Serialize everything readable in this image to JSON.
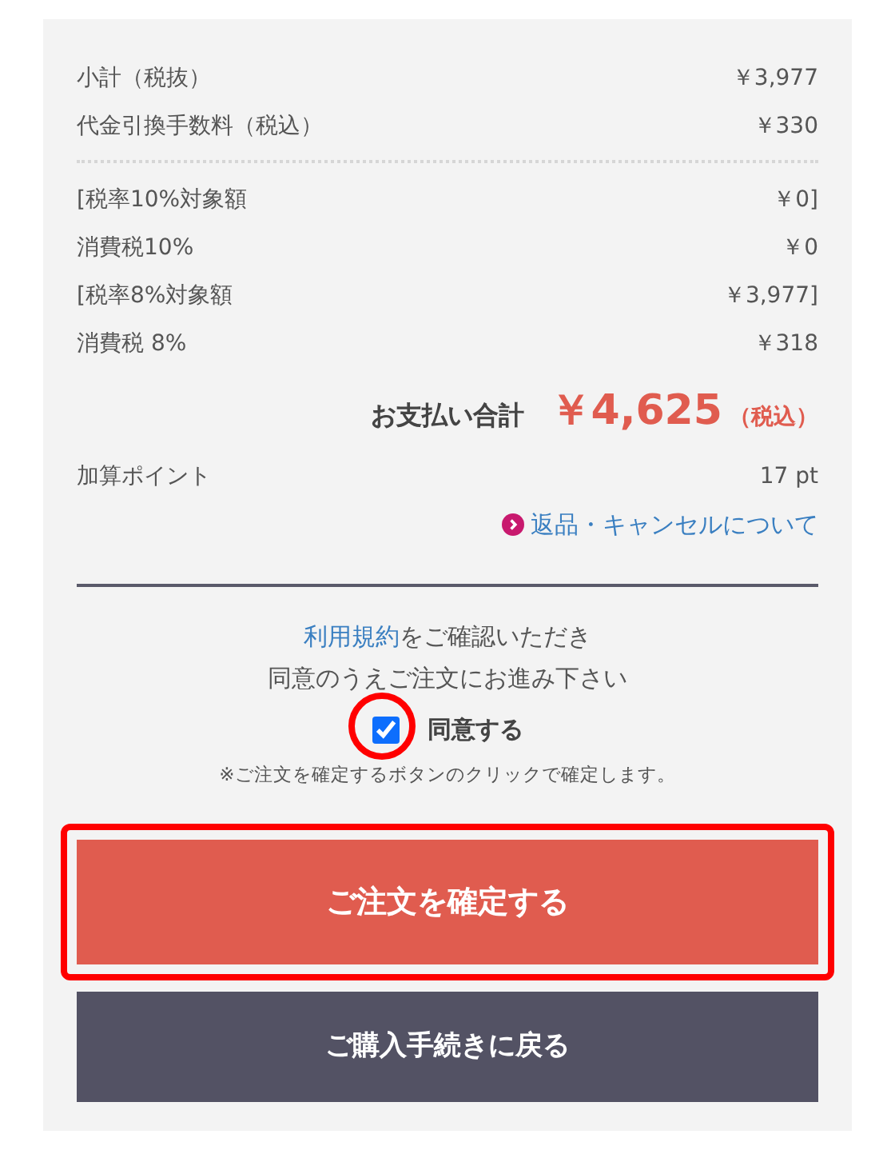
{
  "summary_rows": [
    {
      "label": "小計（税抜）",
      "value": "￥3,977"
    },
    {
      "label": "代金引換手数料（税込）",
      "value": "￥330"
    }
  ],
  "tax_rows": [
    {
      "label": "[税率10%対象額",
      "value": "￥0]"
    },
    {
      "label": "消費税10%",
      "value": "￥0"
    },
    {
      "label": "[税率8%対象額",
      "value": "￥3,977]"
    },
    {
      "label": "消費税 8%",
      "value": "￥318"
    }
  ],
  "total": {
    "label": "お支払い合計",
    "amount": "￥4,625",
    "note": "（税込）"
  },
  "points": {
    "label": "加算ポイント",
    "value": "17 pt"
  },
  "returns_link": "返品・キャンセルについて",
  "terms": {
    "link": "利用規約",
    "line_1_rest": "をご確認いただき",
    "line_2": "同意のうえご注文にお進み下さい"
  },
  "agree": {
    "label": "同意する",
    "checked": true
  },
  "notice": "※ご注文を確定するボタンのクリックで確定します。",
  "buttons": [
    {
      "label": "ご注文を確定する",
      "kind": "primary",
      "highlighted": true
    },
    {
      "label": "ご購入手続きに戻る",
      "kind": "secondary",
      "highlighted": false
    }
  ],
  "checkbox_highlighted": true
}
